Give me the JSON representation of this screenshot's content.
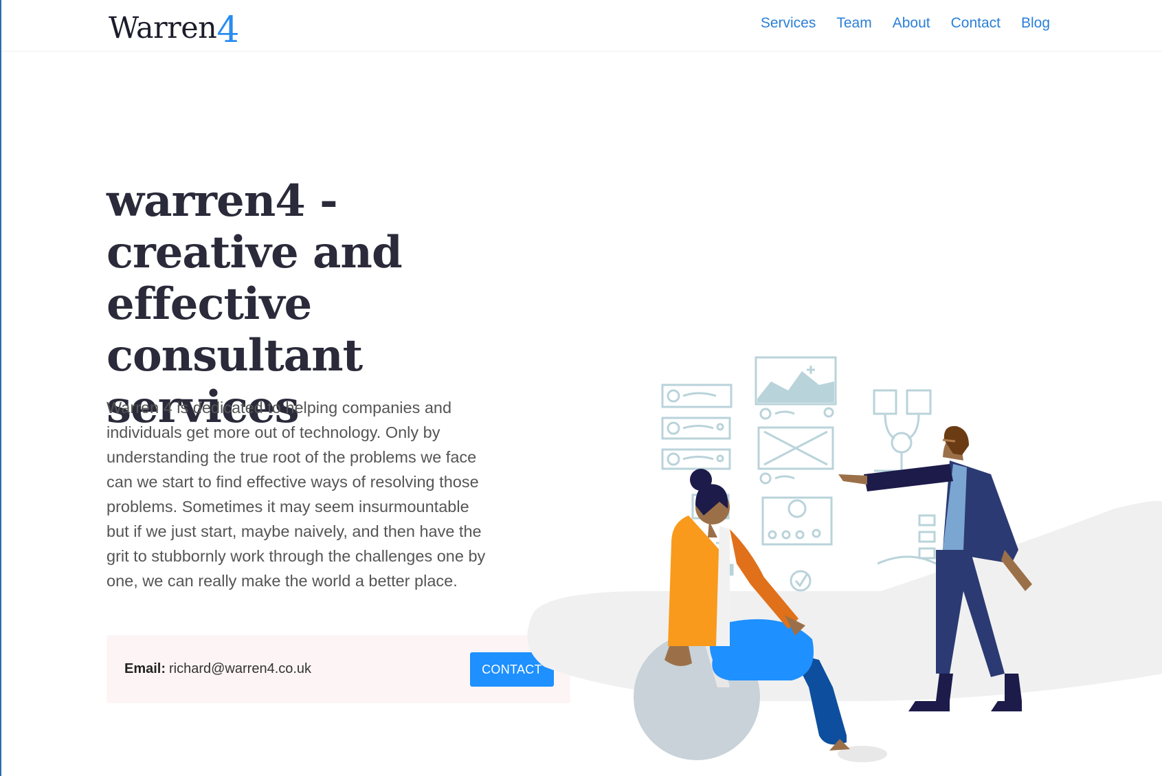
{
  "header": {
    "logo_text": "Warren",
    "logo_number": "4",
    "nav": [
      {
        "label": "Services"
      },
      {
        "label": "Team"
      },
      {
        "label": "About"
      },
      {
        "label": "Contact"
      },
      {
        "label": "Blog"
      }
    ]
  },
  "hero": {
    "headline": "warren4 - creative and effective consultant services",
    "description": "Warren 4 is dedicated to helping companies and individuals get more out of technology. Only by understanding the true root of the problems we face can we start to find effective ways of resolving those problems. Sometimes it may seem insurmountable but if we just start, maybe naively, and then have the grit to stubbornly work through the challenges one by one, we can really make the world a better place.",
    "email_label": "Email:",
    "email_value": "richard@warren4.co.uk",
    "contact_button": "CONTACT"
  },
  "colors": {
    "accent": "#1e90ff",
    "nav_link": "#2a7fd8",
    "headline": "#2a2a3a",
    "contact_box_bg": "#fdf5f5"
  }
}
